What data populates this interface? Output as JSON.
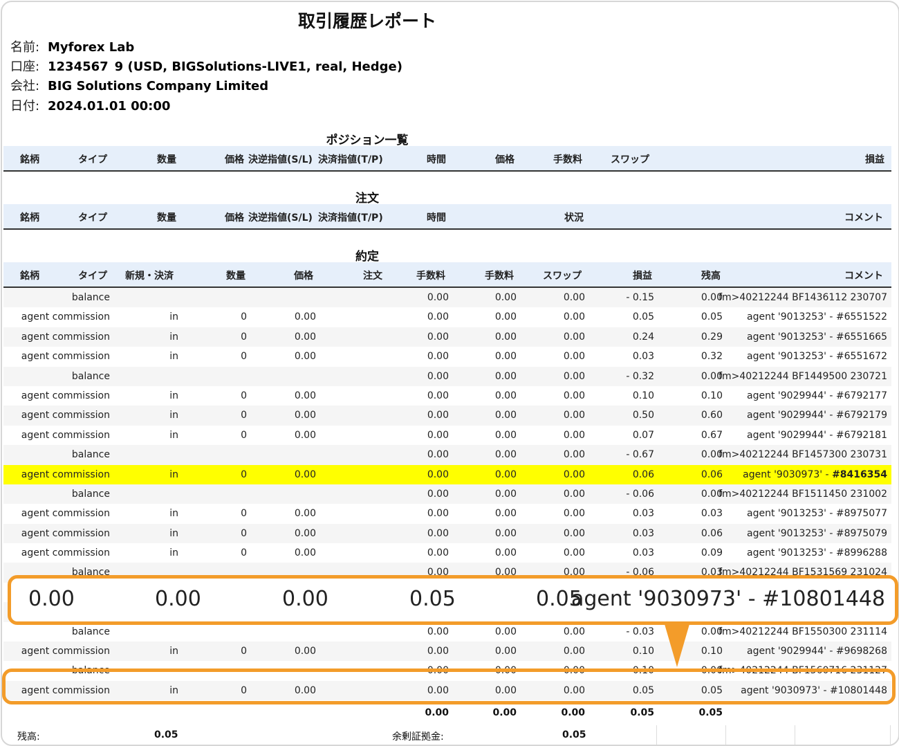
{
  "report": {
    "title": "取引履歴レポート",
    "name_label": "名前:",
    "name_value": "Myforex Lab",
    "account_label": "口座:",
    "account_value": "1234567 9 (USD, BIGSolutions-LIVE1, real, Hedge)",
    "company_label": "会社:",
    "company_value": "BIG Solutions Company Limited",
    "date_label": "日付:",
    "date_value": "2024.01.01 00:00"
  },
  "positions": {
    "section_title": "ポジション一覧",
    "columns": [
      "銘柄",
      "タイプ",
      "数量",
      "価格",
      "決逆指値(S/L)",
      "決済指値(T/P)",
      "時間",
      "価格",
      "手数料",
      "スワップ",
      "損益"
    ]
  },
  "orders": {
    "section_title": "注文",
    "columns": [
      "銘柄",
      "タイプ",
      "数量",
      "価格",
      "決逆指値(S/L)",
      "決済指値(T/P)",
      "時間",
      "状況",
      "コメント"
    ]
  },
  "deals": {
    "section_title": "約定",
    "columns": [
      "銘柄",
      "タイプ",
      "新規・決済",
      "数量",
      "価格",
      "注文",
      "手数料",
      "手数料",
      "スワップ",
      "損益",
      "残高",
      "コメント"
    ],
    "rows": [
      {
        "type": "balance",
        "dir": "",
        "vol": "",
        "price": "",
        "c1": "0.00",
        "c2": "0.00",
        "swap": "0.00",
        "profit": "- 0.15",
        "bal": "0.00",
        "comment": "fm>40212244 BF1436112 230707"
      },
      {
        "type": "agent commission",
        "dir": "in",
        "vol": "0",
        "price": "0.00",
        "c1": "0.00",
        "c2": "0.00",
        "swap": "0.00",
        "profit": "0.05",
        "bal": "0.05",
        "comment": "agent '9013253' - #6551522"
      },
      {
        "type": "agent commission",
        "dir": "in",
        "vol": "0",
        "price": "0.00",
        "c1": "0.00",
        "c2": "0.00",
        "swap": "0.00",
        "profit": "0.24",
        "bal": "0.29",
        "comment": "agent '9013253' - #6551665"
      },
      {
        "type": "agent commission",
        "dir": "in",
        "vol": "0",
        "price": "0.00",
        "c1": "0.00",
        "c2": "0.00",
        "swap": "0.00",
        "profit": "0.03",
        "bal": "0.32",
        "comment": "agent '9013253' - #6551672"
      },
      {
        "type": "balance",
        "dir": "",
        "vol": "",
        "price": "",
        "c1": "0.00",
        "c2": "0.00",
        "swap": "0.00",
        "profit": "- 0.32",
        "bal": "0.00",
        "comment": "fm>40212244 BF1449500 230721"
      },
      {
        "type": "agent commission",
        "dir": "in",
        "vol": "0",
        "price": "0.00",
        "c1": "0.00",
        "c2": "0.00",
        "swap": "0.00",
        "profit": "0.10",
        "bal": "0.10",
        "comment": "agent '9029944' - #6792177"
      },
      {
        "type": "agent commission",
        "dir": "in",
        "vol": "0",
        "price": "0.00",
        "c1": "0.00",
        "c2": "0.00",
        "swap": "0.00",
        "profit": "0.50",
        "bal": "0.60",
        "comment": "agent '9029944' - #6792179"
      },
      {
        "type": "agent commission",
        "dir": "in",
        "vol": "0",
        "price": "0.00",
        "c1": "0.00",
        "c2": "0.00",
        "swap": "0.00",
        "profit": "0.07",
        "bal": "0.67",
        "comment": "agent '9029944' - #6792181"
      },
      {
        "type": "balance",
        "dir": "",
        "vol": "",
        "price": "",
        "c1": "0.00",
        "c2": "0.00",
        "swap": "0.00",
        "profit": "- 0.67",
        "bal": "0.00",
        "comment": "fm>40212244 BF1457300 230731"
      },
      {
        "type": "agent commission",
        "dir": "in",
        "vol": "0",
        "price": "0.00",
        "c1": "0.00",
        "c2": "0.00",
        "swap": "0.00",
        "profit": "0.06",
        "bal": "0.06",
        "comment": "agent '9030973' - ",
        "comment_bold": "#8416354",
        "highlight": true
      },
      {
        "type": "balance",
        "dir": "",
        "vol": "",
        "price": "",
        "c1": "0.00",
        "c2": "0.00",
        "swap": "0.00",
        "profit": "- 0.06",
        "bal": "0.00",
        "comment": "fm>40212244 BF1511450 231002"
      },
      {
        "type": "agent commission",
        "dir": "in",
        "vol": "0",
        "price": "0.00",
        "c1": "0.00",
        "c2": "0.00",
        "swap": "0.00",
        "profit": "0.03",
        "bal": "0.03",
        "comment": "agent '9013253' - #8975077"
      },
      {
        "type": "agent commission",
        "dir": "in",
        "vol": "0",
        "price": "0.00",
        "c1": "0.00",
        "c2": "0.00",
        "swap": "0.00",
        "profit": "0.03",
        "bal": "0.06",
        "comment": "agent '9013253' - #8975079"
      },
      {
        "type": "agent commission",
        "dir": "in",
        "vol": "0",
        "price": "0.00",
        "c1": "0.00",
        "c2": "0.00",
        "swap": "0.00",
        "profit": "0.03",
        "bal": "0.09",
        "comment": "agent '9013253' - #8996288"
      },
      {
        "type": "balance",
        "dir": "",
        "vol": "",
        "price": "",
        "c1": "0.00",
        "c2": "0.00",
        "swap": "0.00",
        "profit": "- 0.06",
        "bal": "0.03",
        "comment": "fm>40212244 BF1531569 231024"
      },
      {
        "type": "",
        "dir": "",
        "vol": "",
        "price": "",
        "c1": "",
        "c2": "",
        "swap": "",
        "profit": "",
        "bal": "",
        "comment": ""
      },
      {
        "type": "",
        "dir": "",
        "vol": "",
        "price": "",
        "c1": "",
        "c2": "",
        "swap": "",
        "profit": "",
        "bal": "",
        "comment": ""
      },
      {
        "type": "balance",
        "dir": "",
        "vol": "",
        "price": "",
        "c1": "0.00",
        "c2": "0.00",
        "swap": "0.00",
        "profit": "- 0.03",
        "bal": "0.00",
        "comment": "fm>40212244 BF1550300 231114"
      },
      {
        "type": "agent commission",
        "dir": "in",
        "vol": "0",
        "price": "0.00",
        "c1": "0.00",
        "c2": "0.00",
        "swap": "0.00",
        "profit": "0.10",
        "bal": "0.10",
        "comment": "agent '9029944' - #9698268"
      },
      {
        "type": "balance",
        "dir": "",
        "vol": "",
        "price": "",
        "c1": "0.00",
        "c2": "0.00",
        "swap": "0.00",
        "profit": "- 0.10",
        "bal": "0.00",
        "comment": "fm>40212244 BF1560716 231127"
      },
      {
        "type": "agent commission",
        "dir": "in",
        "vol": "0",
        "price": "0.00",
        "c1": "0.00",
        "c2": "0.00",
        "swap": "0.00",
        "profit": "0.05",
        "bal": "0.05",
        "comment": "agent '9030973' - #10801448"
      }
    ],
    "totals": [
      "0.00",
      "0.00",
      "0.00",
      "0.05",
      "0.05"
    ]
  },
  "zoom": {
    "values": [
      "0.00",
      "0.00",
      "0.00",
      "0.05",
      "0.05"
    ],
    "comment": "agent '9030973' - #10801448"
  },
  "footer": {
    "balance_label": "残高:",
    "balance_value": "0.05",
    "free_margin_label": "余剰証拠金:",
    "free_margin_value": "0.05"
  },
  "colors": {
    "header_bg": "#e6effa",
    "highlight": "#ffff00",
    "callout": "#f39c2a"
  }
}
